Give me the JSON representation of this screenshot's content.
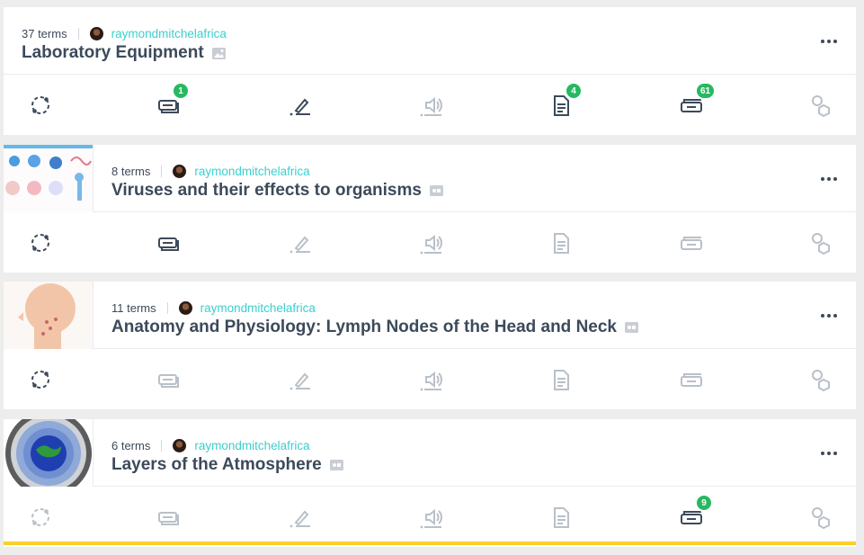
{
  "sets": [
    {
      "terms": "37 terms",
      "user": "raymondmitchelafrica",
      "title": "Laboratory Equipment",
      "title_icon": "image-icon",
      "thumbnail": null,
      "actions": [
        {
          "name": "learn",
          "state": "dark",
          "badge": null
        },
        {
          "name": "flashcards",
          "state": "dark",
          "badge": "1"
        },
        {
          "name": "write",
          "state": "dark",
          "badge": null
        },
        {
          "name": "spell",
          "state": "light",
          "badge": null
        },
        {
          "name": "test",
          "state": "dark",
          "badge": "4"
        },
        {
          "name": "match",
          "state": "dark",
          "badge": "61"
        },
        {
          "name": "gravity",
          "state": "light",
          "badge": null
        }
      ]
    },
    {
      "terms": "8 terms",
      "user": "raymondmitchelafrica",
      "title": "Viruses and their effects to organisms",
      "title_icon": "diagram-icon",
      "thumbnail": "viruses",
      "actions": [
        {
          "name": "learn",
          "state": "dark",
          "badge": null
        },
        {
          "name": "flashcards",
          "state": "dark",
          "badge": null
        },
        {
          "name": "write",
          "state": "light",
          "badge": null
        },
        {
          "name": "spell",
          "state": "light",
          "badge": null
        },
        {
          "name": "test",
          "state": "light",
          "badge": null
        },
        {
          "name": "match",
          "state": "light",
          "badge": null
        },
        {
          "name": "gravity",
          "state": "light",
          "badge": null
        }
      ]
    },
    {
      "terms": "11 terms",
      "user": "raymondmitchelafrica",
      "title": "Anatomy and Physiology: Lymph Nodes of the Head and Neck",
      "title_icon": "diagram-icon",
      "thumbnail": "anatomy",
      "actions": [
        {
          "name": "learn",
          "state": "dark",
          "badge": null
        },
        {
          "name": "flashcards",
          "state": "light",
          "badge": null
        },
        {
          "name": "write",
          "state": "light",
          "badge": null
        },
        {
          "name": "spell",
          "state": "light",
          "badge": null
        },
        {
          "name": "test",
          "state": "light",
          "badge": null
        },
        {
          "name": "match",
          "state": "light",
          "badge": null
        },
        {
          "name": "gravity",
          "state": "light",
          "badge": null
        }
      ]
    },
    {
      "terms": "6 terms",
      "user": "raymondmitchelafrica",
      "title": "Layers of the Atmosphere",
      "title_icon": "diagram-icon",
      "thumbnail": "atmosphere",
      "actions": [
        {
          "name": "learn",
          "state": "light",
          "badge": null
        },
        {
          "name": "flashcards",
          "state": "light",
          "badge": null
        },
        {
          "name": "write",
          "state": "light",
          "badge": null
        },
        {
          "name": "spell",
          "state": "light",
          "badge": null
        },
        {
          "name": "test",
          "state": "light",
          "badge": null
        },
        {
          "name": "match",
          "state": "dark",
          "badge": "9"
        },
        {
          "name": "gravity",
          "state": "light",
          "badge": null
        }
      ]
    }
  ],
  "colors": {
    "accent": "#3ccfcf",
    "badge": "#27b862",
    "highlight": "#f8cf2d",
    "text": "#3c4a5a",
    "inactive": "#b9c0c8"
  }
}
